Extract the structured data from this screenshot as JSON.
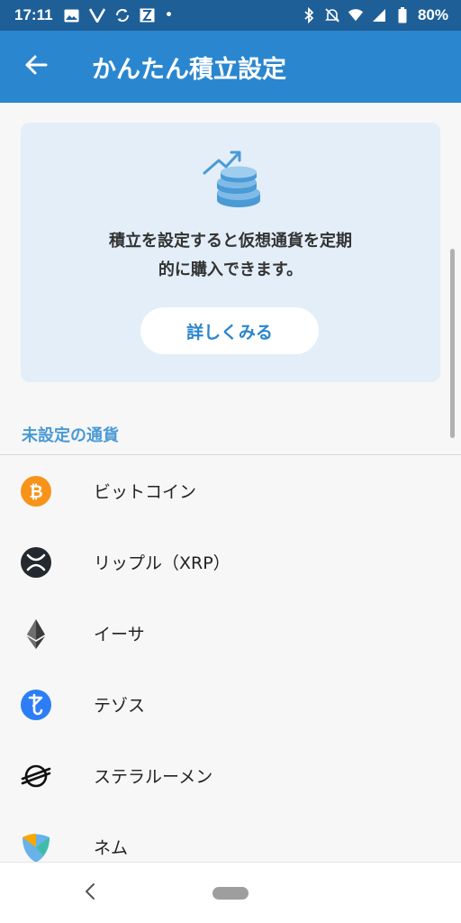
{
  "status_bar": {
    "time": "17:11",
    "dot": "•",
    "battery": "80%",
    "icons": [
      "gallery-icon",
      "v-app-icon",
      "sync-app-icon",
      "x-app-icon",
      "bluetooth-icon",
      "notifications-off-icon",
      "wifi-icon",
      "signal-icon",
      "battery-icon"
    ]
  },
  "app_bar": {
    "title": "かんたん積立設定",
    "back_icon": "arrow-back-icon"
  },
  "info_card": {
    "illustration": "coins-growth-icon",
    "line1": "積立を設定すると仮想通貨を定期",
    "line2": "的に購入できます。",
    "button_label": "詳しくみる"
  },
  "section_header": "未設定の通貨",
  "currencies": [
    {
      "name": "ビットコイン",
      "icon": "bitcoin-icon",
      "color": "#f7931a"
    },
    {
      "name": "リップル（XRP）",
      "icon": "xrp-icon",
      "color": "#23292f"
    },
    {
      "name": "イーサ",
      "icon": "ethereum-icon",
      "color": "#3c3c3d"
    },
    {
      "name": "テゾス",
      "icon": "tezos-icon",
      "color": "#2c7df7"
    },
    {
      "name": "ステラルーメン",
      "icon": "stellar-icon",
      "color": "#111111"
    },
    {
      "name": "ネム",
      "icon": "nem-icon",
      "color": "#67b2e8"
    }
  ],
  "colors": {
    "status_bar": "#1f5f97",
    "app_bar": "#2a86cf",
    "accent": "#2a86cf",
    "section_header": "#4a9ad6",
    "card_background": "#e3eef8"
  }
}
